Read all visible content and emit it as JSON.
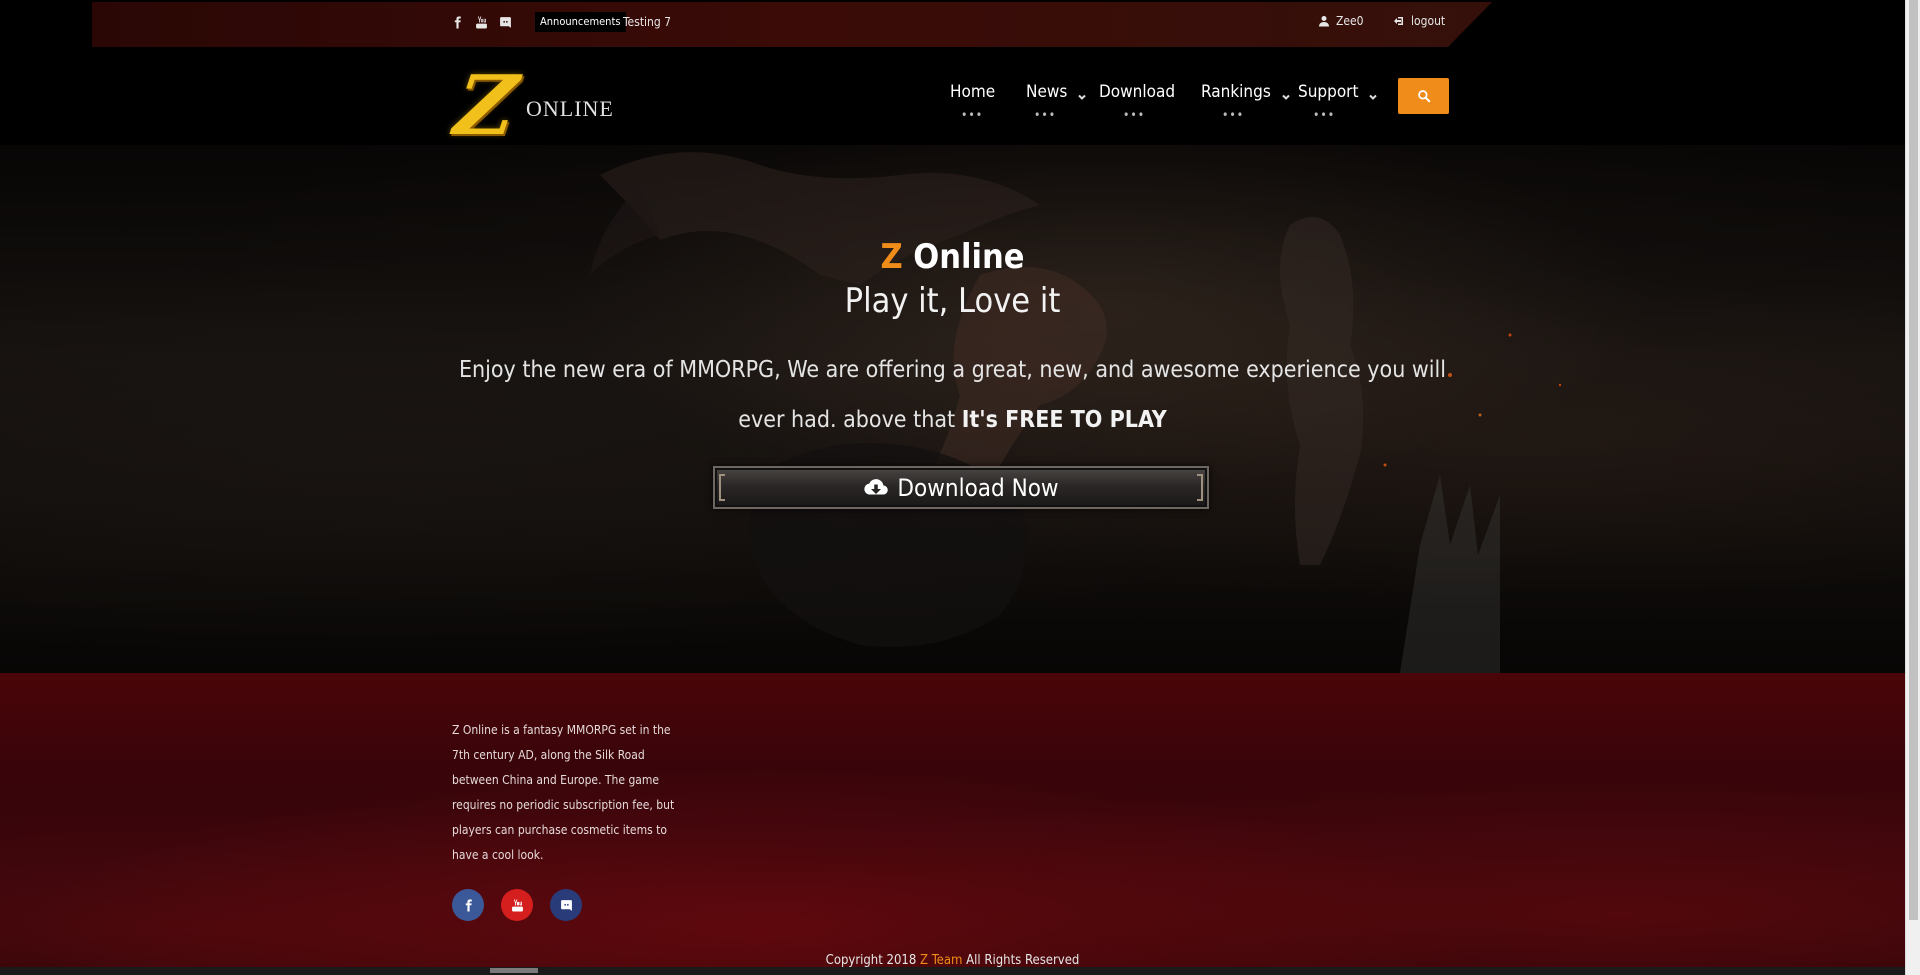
{
  "topbar": {
    "social_icons": [
      "facebook-icon",
      "youtube-icon",
      "discord-icon"
    ],
    "announcement_badge": "Announcements",
    "announcement_text": "Testing 7",
    "username": "Zee0",
    "logout_label": "logout"
  },
  "header": {
    "logo_letter": "Z",
    "logo_word": "ONLINE",
    "nav": [
      {
        "label": "Home",
        "has_dropdown": false
      },
      {
        "label": "News",
        "has_dropdown": true
      },
      {
        "label": "Download",
        "has_dropdown": false
      },
      {
        "label": "Rankings",
        "has_dropdown": true
      },
      {
        "label": "Support",
        "has_dropdown": true
      }
    ],
    "nav_dots": "•••",
    "search_icon": "search-icon"
  },
  "hero": {
    "title_prefix": "Z",
    "title_rest": " Online",
    "subtitle": "Play it, Love it",
    "description": "Enjoy the new era of MMORPG, We are offering a great, new, and awesome experience you will ever had. above that ",
    "description_bold": "It's FREE TO PLAY",
    "download_label": "Download Now"
  },
  "footer": {
    "about": "Z Online is a fantasy MMORPG set in the 7th century AD, along the Silk Road between China and Europe. The game requires no periodic subscription fee, but players can purchase cosmetic items to have a cool look.",
    "social_icons": [
      "facebook-icon",
      "youtube-icon",
      "discord-icon"
    ],
    "copyright_prefix": "Copyright 2018 ",
    "copyright_team": "Z Team",
    "copyright_suffix": " All Rights Reserved"
  },
  "colors": {
    "accent": "#f08c1a",
    "topbar_bg": "#3a0b07",
    "footer_bg": "#3a050a"
  }
}
